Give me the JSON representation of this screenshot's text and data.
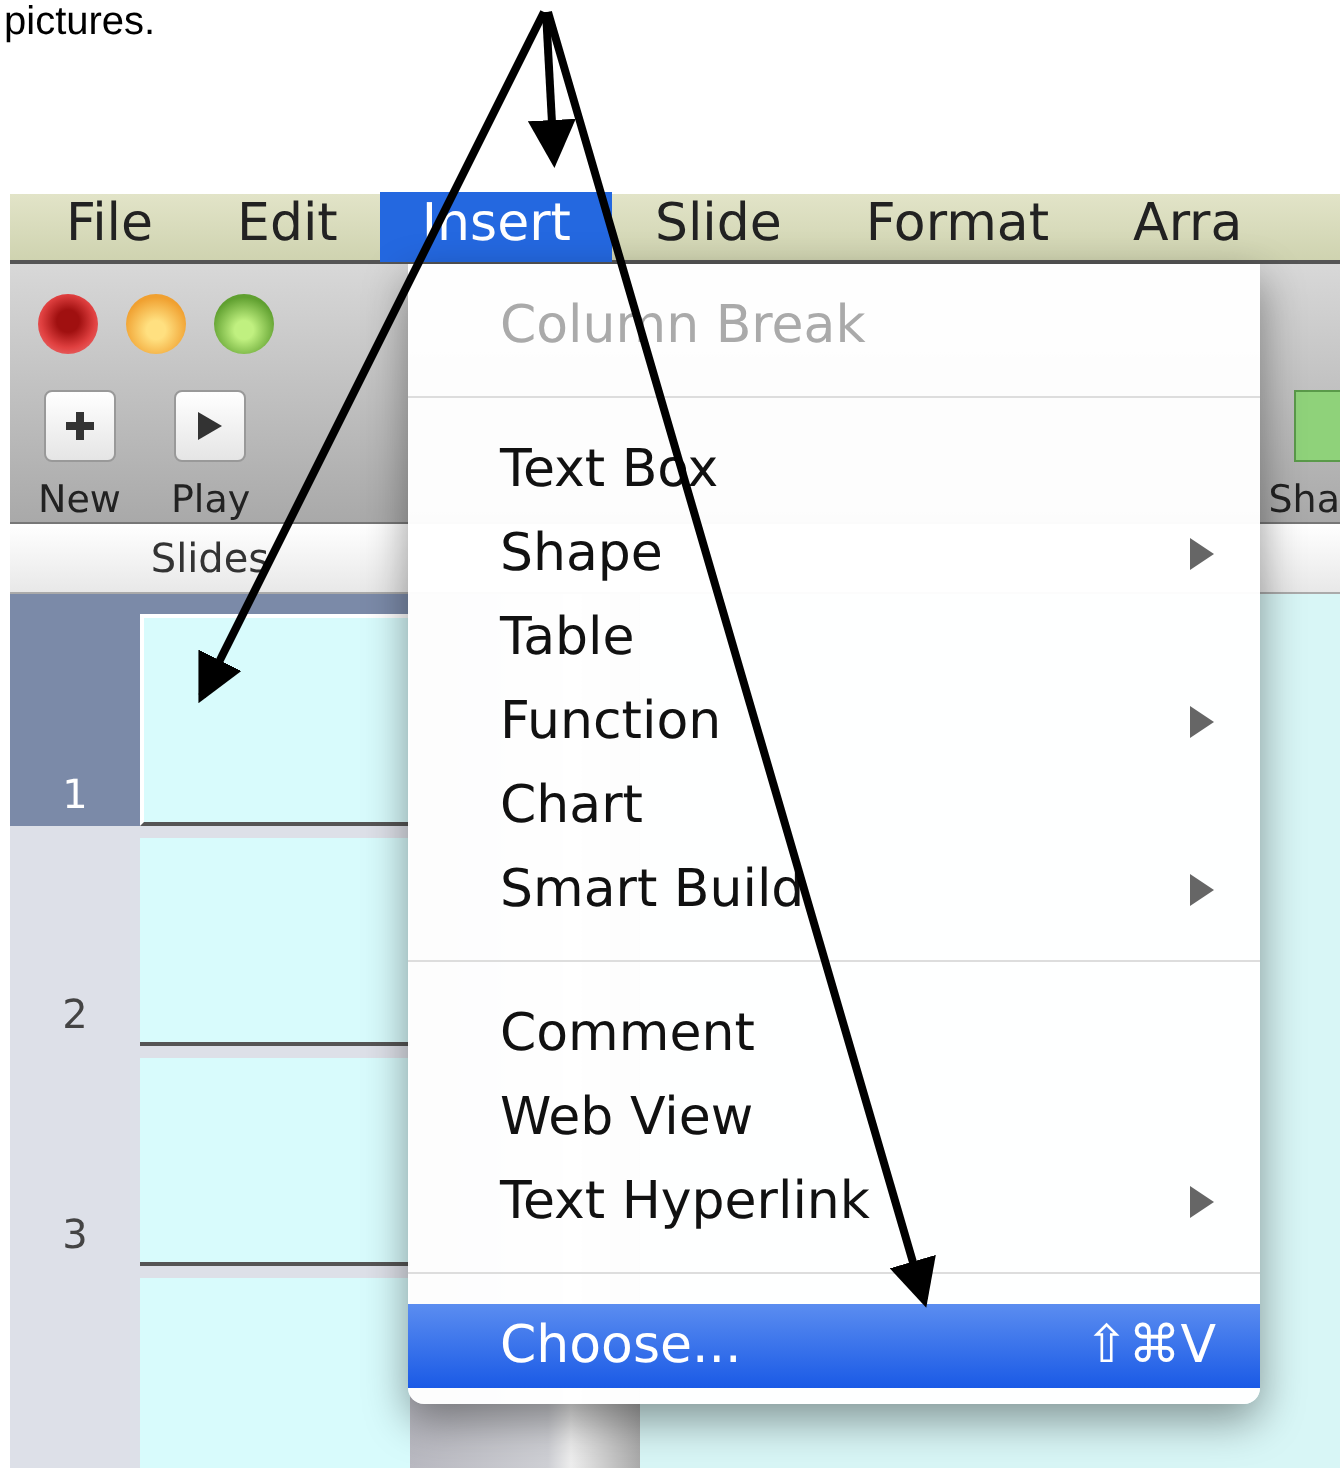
{
  "caption": "pictures.",
  "menu_bar": [
    {
      "label": "File",
      "selected": false
    },
    {
      "label": "Edit",
      "selected": false
    },
    {
      "label": "Insert",
      "selected": true
    },
    {
      "label": "Slide",
      "selected": false
    },
    {
      "label": "Format",
      "selected": false
    },
    {
      "label": "Arra",
      "selected": false
    }
  ],
  "toolbar": [
    {
      "label": "New",
      "kind": "plus"
    },
    {
      "label": "Play",
      "kind": "play"
    },
    {
      "label": "Sha",
      "kind": "shape"
    }
  ],
  "sidebar": {
    "title": "Slides",
    "slides": [
      {
        "number": "1",
        "selected": true
      },
      {
        "number": "2",
        "selected": false
      },
      {
        "number": "3",
        "selected": false
      },
      {
        "selected": false
      }
    ]
  },
  "menu": {
    "items": [
      {
        "kind": "item",
        "label": "Column Break",
        "disabled": true,
        "submenu": false,
        "selected": false
      },
      {
        "kind": "separator"
      },
      {
        "kind": "item",
        "label": "Text Box",
        "disabled": false,
        "submenu": false,
        "selected": false
      },
      {
        "kind": "item",
        "label": "Shape",
        "disabled": false,
        "submenu": true,
        "selected": false
      },
      {
        "kind": "item",
        "label": "Table",
        "disabled": false,
        "submenu": false,
        "selected": false
      },
      {
        "kind": "item",
        "label": "Function",
        "disabled": false,
        "submenu": true,
        "selected": false
      },
      {
        "kind": "item",
        "label": "Chart",
        "disabled": false,
        "submenu": false,
        "selected": false
      },
      {
        "kind": "item",
        "label": "Smart Build",
        "disabled": false,
        "submenu": true,
        "selected": false
      },
      {
        "kind": "separator"
      },
      {
        "kind": "item",
        "label": "Comment",
        "disabled": false,
        "submenu": false,
        "selected": false
      },
      {
        "kind": "item",
        "label": "Web View",
        "disabled": false,
        "submenu": false,
        "selected": false
      },
      {
        "kind": "item",
        "label": "Text Hyperlink",
        "disabled": false,
        "submenu": true,
        "selected": false
      },
      {
        "kind": "separator"
      },
      {
        "kind": "item",
        "label": "Choose...",
        "disabled": false,
        "submenu": false,
        "selected": true,
        "shortcut": "⇧⌘V"
      }
    ]
  }
}
